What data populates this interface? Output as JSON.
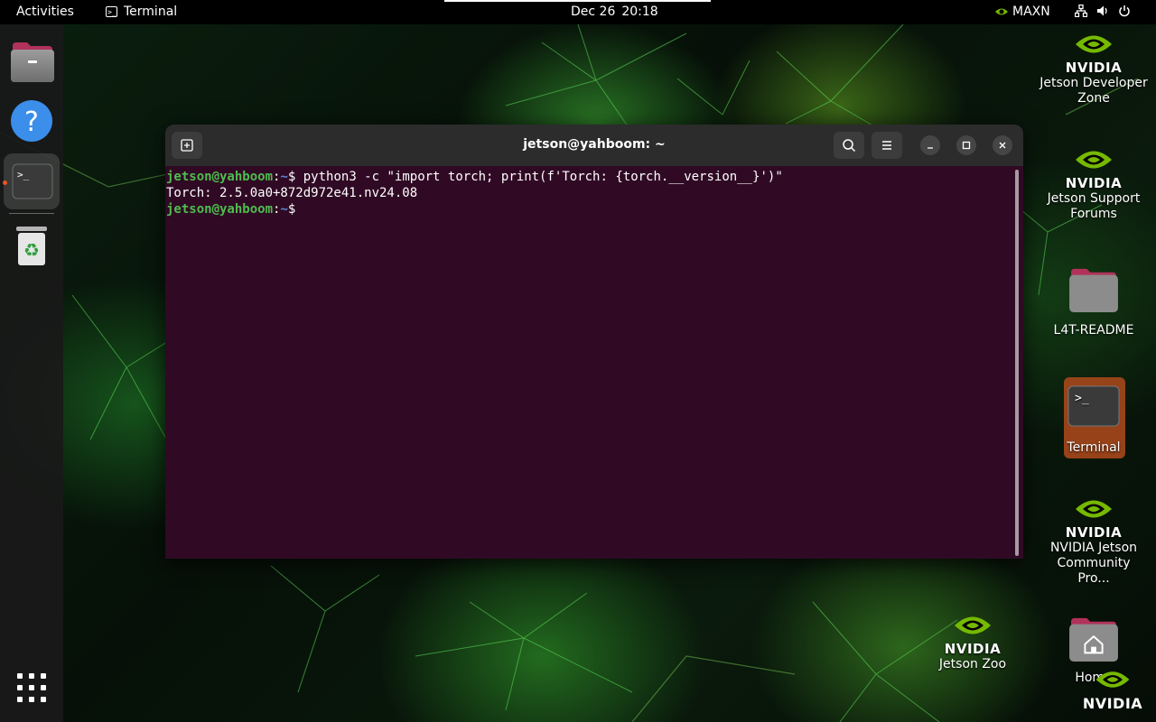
{
  "topbar": {
    "activities": "Activities",
    "app_name": "Terminal",
    "date": "Dec 26",
    "time": "20:18",
    "power_mode": "MAXN"
  },
  "dock": {
    "items": [
      {
        "name": "Files"
      },
      {
        "name": "Help"
      },
      {
        "name": "Terminal",
        "running": true
      },
      {
        "name": "Trash"
      }
    ]
  },
  "terminal": {
    "title": "jetson@yahboom: ~",
    "lines": [
      {
        "user": "jetson@yahboom",
        "sep": ":",
        "path": "~",
        "symbol": "$",
        "cmd": " python3 -c \"import torch; print(f'Torch: {torch.__version__}')\""
      },
      {
        "output": "Torch: 2.5.0a0+872d972e41.nv24.08"
      },
      {
        "user": "jetson@yahboom",
        "sep": ":",
        "path": "~",
        "symbol": "$",
        "cmd": " "
      }
    ]
  },
  "desktop": {
    "icons": [
      {
        "brand": "NVIDIA",
        "label_1": "Jetson Developer",
        "label_2": "Zone"
      },
      {
        "brand": "NVIDIA",
        "label_1": "Jetson Support",
        "label_2": "Forums"
      },
      {
        "label_1": "L4T-README"
      },
      {
        "label_1": "Terminal",
        "glyph": ">_"
      },
      {
        "brand": "NVIDIA",
        "label_1": "NVIDIA Jetson",
        "label_2": "Community Pro..."
      },
      {
        "brand": "NVIDIA",
        "label_1": "Jetson Zoo"
      },
      {
        "label_1": "Home"
      }
    ],
    "corner_brand": "NVIDIA"
  },
  "colors": {
    "terminal_bg": "#300a24",
    "prompt_user": "#4ebd4e",
    "prompt_path": "#5f87d7",
    "accent": "#e95420",
    "nvidia_green": "#76b900"
  }
}
